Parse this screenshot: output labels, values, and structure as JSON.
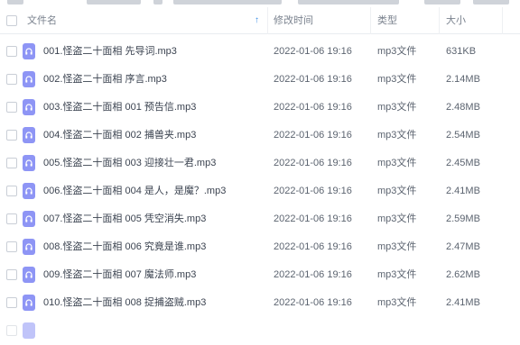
{
  "table": {
    "headers": {
      "name": "文件名",
      "modified": "修改时间",
      "type": "类型",
      "size": "大小"
    },
    "sort_arrow": "↑",
    "rows": [
      {
        "name": "001.怪盗二十面相 先导词.mp3",
        "modified": "2022-01-06 19:16",
        "type": "mp3文件",
        "size": "631KB"
      },
      {
        "name": "002.怪盗二十面相 序言.mp3",
        "modified": "2022-01-06 19:16",
        "type": "mp3文件",
        "size": "2.14MB"
      },
      {
        "name": "003.怪盗二十面相 001 预告信.mp3",
        "modified": "2022-01-06 19:16",
        "type": "mp3文件",
        "size": "2.48MB"
      },
      {
        "name": "004.怪盗二十面相 002 捕兽夹.mp3",
        "modified": "2022-01-06 19:16",
        "type": "mp3文件",
        "size": "2.54MB"
      },
      {
        "name": "005.怪盗二十面相 003 迎接壮一君.mp3",
        "modified": "2022-01-06 19:16",
        "type": "mp3文件",
        "size": "2.45MB"
      },
      {
        "name": "006.怪盗二十面相 004 是人，是魔？.mp3",
        "modified": "2022-01-06 19:16",
        "type": "mp3文件",
        "size": "2.41MB"
      },
      {
        "name": "007.怪盗二十面相 005 凭空消失.mp3",
        "modified": "2022-01-06 19:16",
        "type": "mp3文件",
        "size": "2.59MB"
      },
      {
        "name": "008.怪盗二十面相 006 究竟是谁.mp3",
        "modified": "2022-01-06 19:16",
        "type": "mp3文件",
        "size": "2.47MB"
      },
      {
        "name": "009.怪盗二十面相 007 魔法师.mp3",
        "modified": "2022-01-06 19:16",
        "type": "mp3文件",
        "size": "2.62MB"
      },
      {
        "name": "010.怪盗二十面相 008 捉捕盗贼.mp3",
        "modified": "2022-01-06 19:16",
        "type": "mp3文件",
        "size": "2.41MB"
      }
    ]
  },
  "colors": {
    "file_icon": "#8e95f5",
    "sort_accent": "#3a8ee6"
  },
  "icons": {
    "file": "audio-file-icon"
  }
}
